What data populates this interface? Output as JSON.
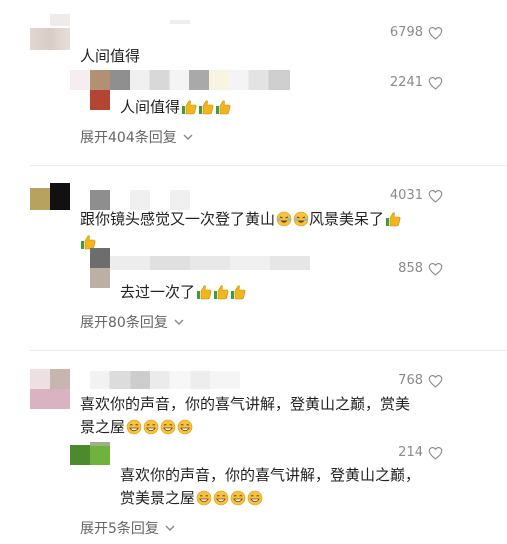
{
  "colors": {
    "accent": "#f3b51c",
    "muted": "#8a8a8a"
  },
  "comments": [
    {
      "likes": "6798",
      "text": "人间值得",
      "reply": {
        "likes": "2241",
        "text": "人间值得",
        "emoji": [
          "thumbs-up",
          "thumbs-up",
          "thumbs-up"
        ]
      },
      "expand": "展开404条回复"
    },
    {
      "likes": "4031",
      "text_a": "跟你镜头感觉又一次登了黄山",
      "text_b": "风景美呆了",
      "emoji_a": [
        "laugh-cry",
        "laugh-cry"
      ],
      "emoji_b": [
        "thumbs-up"
      ],
      "emoji_c": [
        "thumbs-up"
      ],
      "reply": {
        "likes": "858",
        "text": "去过一次了",
        "emoji": [
          "thumbs-up",
          "thumbs-up",
          "thumbs-up"
        ]
      },
      "expand": "展开80条回复"
    },
    {
      "likes": "768",
      "text_line1": "喜欢你的声音，你的喜气讲解，登黄山之巅，赏美",
      "text_line2": "景之屋",
      "emoji": [
        "grin",
        "grin",
        "grin",
        "grin"
      ],
      "reply": {
        "likes": "214",
        "text_line1": "喜欢你的声音，你的喜气讲解，登黄山之巅，",
        "text_line2": "赏美景之屋",
        "emoji": [
          "grin",
          "grin",
          "grin",
          "grin"
        ]
      },
      "expand": "展开5条回复"
    }
  ]
}
